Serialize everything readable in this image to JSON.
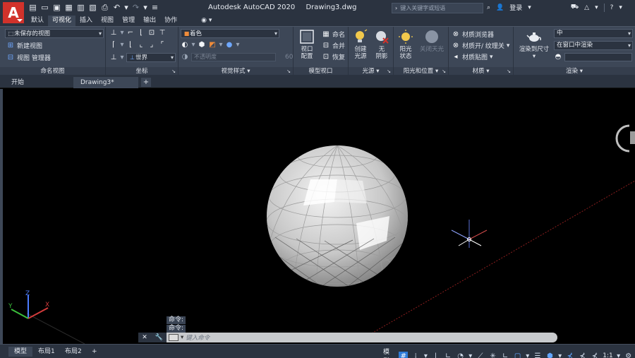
{
  "app": {
    "logo_letter": "A",
    "title": "Autodesk AutoCAD 2020",
    "filename": "Drawing3.dwg",
    "search_placeholder": "键入关键字或短语",
    "login": "登录"
  },
  "ribbon_tabs": [
    "默认",
    "可视化",
    "插入",
    "视图",
    "管理",
    "输出",
    "协作"
  ],
  "active_ribbon_tab": 1,
  "panels": {
    "named_views": {
      "label": "命名视图",
      "saved_view": "未保存的视图",
      "new_view": "新建视图",
      "view_manager": "视图 管理器"
    },
    "coordinates": {
      "label": "坐标",
      "ucs": "世界"
    },
    "visual_styles": {
      "label": "视觉样式",
      "style": "着色",
      "opacity_label": "不透明度",
      "opacity_value": "60"
    },
    "model_viewports": {
      "label": "模型视口",
      "config_label": "视口\n配置",
      "name": "命名",
      "join": "合并",
      "restore": "恢复"
    },
    "lights": {
      "label": "光源",
      "create_light": "创建\n光源",
      "no_shadow": "无\n阴影"
    },
    "sun": {
      "label": "阳光和位置",
      "sun_status": "阳光\n状态",
      "sky_off": "关闭天光"
    },
    "materials": {
      "label": "材质",
      "browser": "材质浏览器",
      "on_off": "材质开/ 纹理关",
      "mapping": "材质贴图"
    },
    "render": {
      "label": "渲染",
      "render_to_size": "渲染到尺寸",
      "quality": "中",
      "render_in": "在窗口中渲染"
    }
  },
  "doc_tabs": [
    {
      "label": "开始"
    },
    {
      "label": "Drawing3*",
      "closable": true
    }
  ],
  "command": {
    "history": [
      "命令:",
      "命令:"
    ],
    "placeholder": "键入命令"
  },
  "layout_tabs": [
    "模型",
    "布局1",
    "布局2"
  ],
  "status": {
    "model_label": "模型",
    "scale": "1:1"
  },
  "ucs_axes": {
    "x": "X",
    "y": "Y",
    "z": "Z"
  },
  "colors": {
    "ribbon_bg": "#3d4757",
    "title_bg": "#2b3340",
    "logo_red": "#d1322b",
    "viewport_bg": "#000000"
  }
}
